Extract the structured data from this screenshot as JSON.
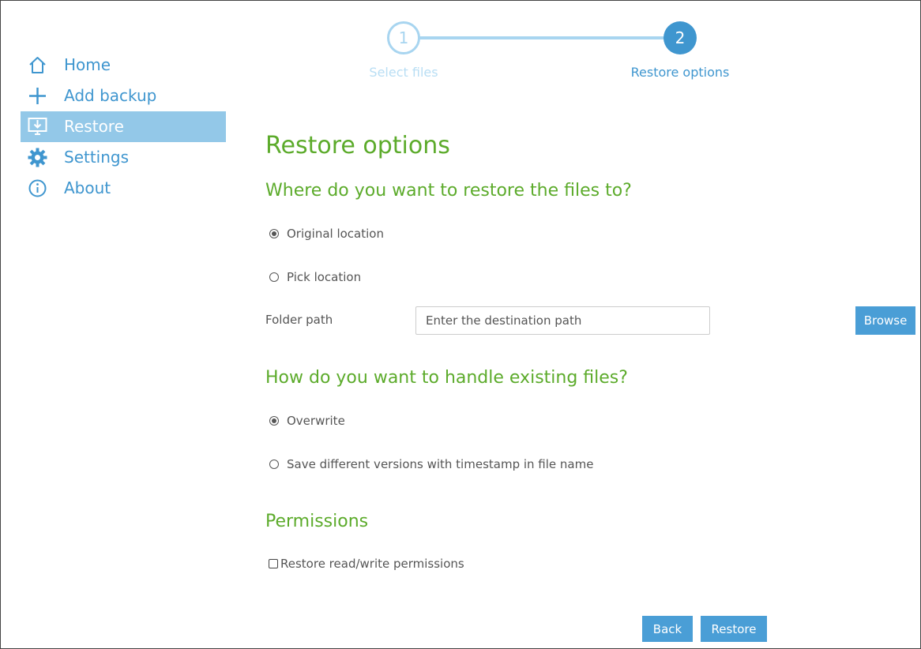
{
  "sidebar": {
    "items": [
      {
        "label": "Home",
        "icon": "home-icon"
      },
      {
        "label": "Add backup",
        "icon": "plus-icon"
      },
      {
        "label": "Restore",
        "icon": "restore-monitor-icon",
        "active": true
      },
      {
        "label": "Settings",
        "icon": "gear-icon"
      },
      {
        "label": "About",
        "icon": "info-icon"
      }
    ]
  },
  "stepper": {
    "steps": [
      {
        "number": "1",
        "label": "Select files",
        "state": "completed"
      },
      {
        "number": "2",
        "label": "Restore options",
        "state": "current"
      }
    ]
  },
  "main": {
    "title": "Restore options",
    "destination": {
      "heading": "Where do you want to restore the files to?",
      "options": [
        {
          "label": "Original location",
          "checked": true
        },
        {
          "label": "Pick location",
          "checked": false
        }
      ],
      "folder_path_label": "Folder path",
      "folder_path_placeholder": "Enter the destination path",
      "folder_path_value": "",
      "browse_label": "Browse"
    },
    "existing": {
      "heading": "How do you want to handle existing files?",
      "options": [
        {
          "label": "Overwrite",
          "checked": true
        },
        {
          "label": "Save different versions with timestamp in file name",
          "checked": false
        }
      ]
    },
    "permissions": {
      "heading": "Permissions",
      "checkbox_label": "Restore read/write permissions",
      "checked": false
    }
  },
  "footer": {
    "back_label": "Back",
    "restore_label": "Restore"
  },
  "colors": {
    "accent_blue": "#3f96cf",
    "active_bg": "#93c8e8",
    "heading_green": "#5cab2b",
    "button_blue": "#4a9ed6",
    "step_light": "#a8d5f0"
  }
}
